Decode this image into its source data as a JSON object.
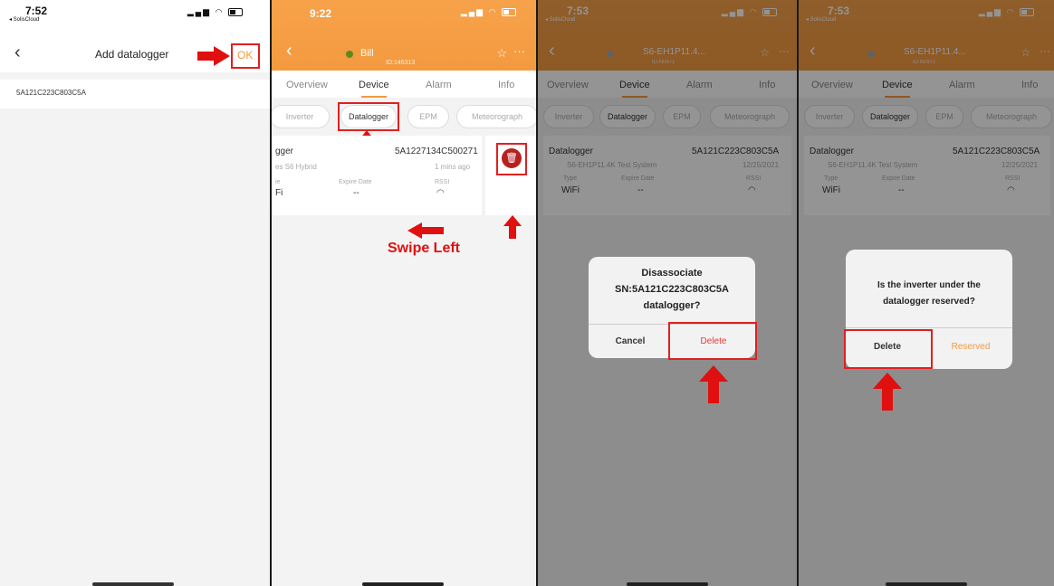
{
  "colors": {
    "accent": "#f39a3f",
    "red": "#e01010",
    "delete_red": "#e53a3a",
    "reserved_orange": "#f39a3f"
  },
  "panel1": {
    "time": "7:52",
    "carrier": "◂ SolisCloud",
    "title": "Add datalogger",
    "ok_label": "OK",
    "serial": "5A121C223C803C5A"
  },
  "panel2": {
    "time": "9:22",
    "plant_name": "Bill",
    "plant_id": "ID:146313",
    "tabs": [
      "Overview",
      "Device",
      "Alarm",
      "Info"
    ],
    "chips": [
      "Inverter",
      "Datalogger",
      "EPM",
      "Meteorograph"
    ],
    "card_title": "gger",
    "card_sn": "5A1227134C500271",
    "card_system": "es S6 Hybrid",
    "card_time": "1 mins ago",
    "type_label": "ie",
    "type_value": "Fi",
    "expire_label": "Expire Date",
    "expire_value": "--",
    "rssi_label": "RSSI",
    "instruction": "Swipe Left"
  },
  "panel3": {
    "time": "7:53",
    "carrier": "◂ SolisCloud",
    "plant_name": "S6-EH1P11.4...",
    "plant_id": "ID:N0971",
    "tabs": [
      "Overview",
      "Device",
      "Alarm",
      "Info"
    ],
    "chips": [
      "Inverter",
      "Datalogger",
      "EPM",
      "Meteorograph"
    ],
    "card_title": "Datalogger",
    "card_sn": "5A121C223C803C5A",
    "card_system": "S6-EH1P11.4K Test System",
    "card_date": "12/25/2021",
    "type_label": "Type",
    "type_value": "WiFi",
    "expire_label": "Expire Date",
    "expire_value": "--",
    "rssi_label": "RSSI",
    "dialog_line1": "Disassociate",
    "dialog_line2": "SN:5A121C223C803C5A",
    "dialog_line3": "datalogger?",
    "cancel_label": "Cancel",
    "delete_label": "Delete"
  },
  "panel4": {
    "time": "7:53",
    "carrier": "◂ SolisCloud",
    "plant_name": "S6-EH1P11.4...",
    "plant_id": "ID:N0971",
    "tabs": [
      "Overview",
      "Device",
      "Alarm",
      "Info"
    ],
    "chips": [
      "Inverter",
      "Datalogger",
      "EPM",
      "Meteorograph"
    ],
    "card_title": "Datalogger",
    "card_sn": "5A121C223C803C5A",
    "card_system": "S6-EH1P11.4K Test System",
    "card_date": "12/25/2021",
    "type_label": "Type",
    "type_value": "WiFi",
    "expire_label": "Expire Date",
    "expire_value": "--",
    "rssi_label": "RSSI",
    "dialog_line1": "Is the inverter under the",
    "dialog_line2": "datalogger reserved?",
    "delete_label": "Delete",
    "reserved_label": "Reserved"
  }
}
